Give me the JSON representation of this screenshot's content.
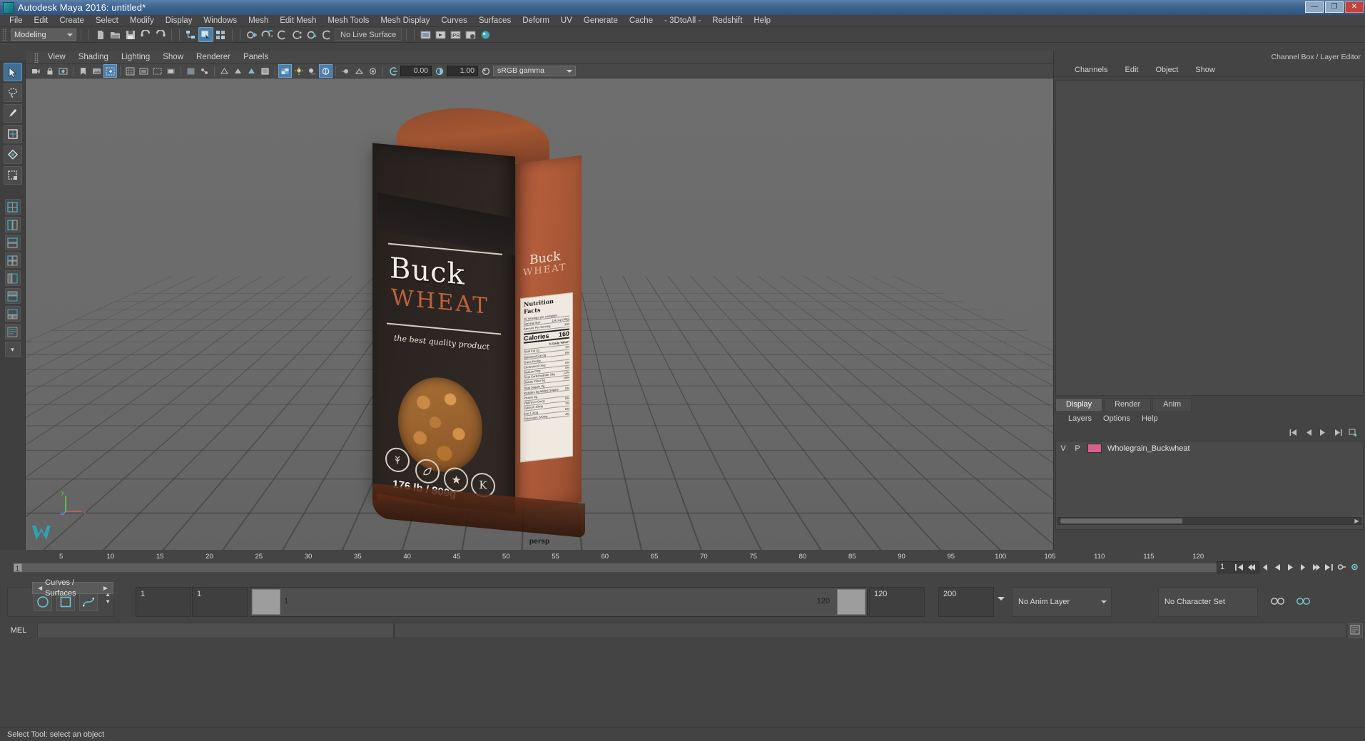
{
  "window": {
    "title": "Autodesk Maya 2016: untitled*",
    "minimize_label": "—",
    "maximize_label": "❐",
    "close_label": "✕"
  },
  "menubar": {
    "items": [
      "File",
      "Edit",
      "Create",
      "Select",
      "Modify",
      "Display",
      "Windows",
      "Mesh",
      "Edit Mesh",
      "Mesh Tools",
      "Mesh Display",
      "Curves",
      "Surfaces",
      "Deform",
      "UV",
      "Generate",
      "Cache",
      "- 3DtoAll -",
      "Redshift",
      "Help"
    ]
  },
  "toolbar": {
    "mode": "Modeling",
    "live_surface": "No Live Surface",
    "icons": [
      "new-scene-icon",
      "open-scene-icon",
      "save-scene-icon",
      "undo-icon",
      "redo-icon",
      "select-by-hierarchy-icon",
      "select-by-object-icon",
      "select-by-component-icon",
      "snap-to-grid-icon",
      "snap-to-curve-icon",
      "snap-to-point-icon",
      "snap-to-projected-center-icon",
      "snap-to-view-plane-icon",
      "make-live-icon",
      "render-view-icon",
      "render-current-frame-icon",
      "ipr-render-icon",
      "render-settings-icon",
      "hypershade-icon"
    ]
  },
  "toolbox": {
    "tools": [
      {
        "name": "select-tool",
        "icon": "arrow-cursor-icon",
        "selected": true
      },
      {
        "name": "lasso-select-tool",
        "icon": "lasso-icon",
        "selected": false
      },
      {
        "name": "paint-select-tool",
        "icon": "paint-brush-icon",
        "selected": false
      },
      {
        "name": "move-tool",
        "icon": "move-arrows-icon",
        "selected": false
      },
      {
        "name": "rotate-tool",
        "icon": "rotate-ring-icon",
        "selected": false
      },
      {
        "name": "scale-tool",
        "icon": "scale-box-icon",
        "selected": false
      },
      {
        "name": "last-tool",
        "icon": "last-tool-icon",
        "selected": false
      }
    ],
    "layout_presets": [
      "single-perspective-layout",
      "two-pane-side-layout",
      "two-pane-stacked-layout",
      "four-pane-layout",
      "persp-outliner-layout",
      "hypershade-layout",
      "persp-graph-layout",
      "outliner-layout"
    ],
    "more_label": "▾"
  },
  "viewport": {
    "menus": [
      "View",
      "Shading",
      "Lighting",
      "Show",
      "Renderer",
      "Panels"
    ],
    "camera_label": "persp",
    "exposure_value": "0.00",
    "gamma_value": "1.00",
    "color_space": "sRGB gamma",
    "toolbar_icons": [
      "select-camera-icon",
      "lock-camera-icon",
      "camera-attributes-icon",
      "bookmark-icon",
      "image-plane-icon",
      "two-d-pan-zoom-icon",
      "grid-toggle-icon",
      "film-gate-icon",
      "resolution-gate-icon",
      "gate-mask-icon",
      "xray-toggle-icon",
      "xray-joints-icon",
      "wireframe-icon",
      "smooth-shade-all-icon",
      "smooth-shade-selected-icon",
      "wireframe-on-shaded-icon",
      "texture-toggle-icon",
      "lights-toggle-icon",
      "shadows-toggle-icon",
      "screen-space-ao-icon",
      "motion-blur-icon",
      "multisample-icon",
      "depth-of-field-icon",
      "exposure-icon",
      "gamma-icon",
      "color-management-icon"
    ]
  },
  "model": {
    "brand_line1": "Buck",
    "brand_line2": "WHEAT",
    "tagline": "the best quality product",
    "weight": "176 lb / 800g",
    "side_brand_line1": "Buck",
    "side_brand_line2": "WHEAT",
    "seals": [
      "wheat-sheaf-seal",
      "leaf-seal",
      "star-seal",
      "kosher-k-seal"
    ],
    "nutrition": {
      "title": "Nutrition Facts",
      "servings": "10 servings per container",
      "serving_size_label": "Serving Size",
      "serving_size_value": "1/4 cup (40g)",
      "amount_label": "Amount Per Serving",
      "amount_value": "160",
      "calories_label": "Calories",
      "calories_value": "160",
      "dv_header": "% Daily Value*",
      "rows": [
        {
          "label": "Total Fat 1g",
          "value": "1%"
        },
        {
          "label": "Saturated Fat 0g",
          "value": "0%"
        },
        {
          "label": "Trans Fat 0g",
          "value": ""
        },
        {
          "label": "Cholesterol 0mg",
          "value": "0%"
        },
        {
          "label": "Sodium 0mg",
          "value": "0%"
        },
        {
          "label": "Total Carbohydrate 33g",
          "value": "12%"
        },
        {
          "label": "Dietary Fiber 5g",
          "value": "18%"
        },
        {
          "label": "Total Sugars 0g",
          "value": ""
        },
        {
          "label": "Includes 0g Added Sugars",
          "value": "0%"
        },
        {
          "label": "Protein 6g",
          "value": ""
        },
        {
          "label": "Vitamin D 0mcg",
          "value": "0%"
        },
        {
          "label": "Calcium 10mg",
          "value": "1%"
        },
        {
          "label": "Iron 1.3mg",
          "value": "8%"
        },
        {
          "label": "Potassium 220mg",
          "value": "4%"
        }
      ]
    }
  },
  "channelbox": {
    "header": "Channel Box / Layer Editor",
    "tabs": [
      "Channels",
      "Edit",
      "Object",
      "Show"
    ],
    "side_icons": [
      "channel-box-toggle-icon",
      "attribute-editor-toggle-icon",
      "tool-settings-icon"
    ]
  },
  "layereditor": {
    "tabs": [
      {
        "label": "Display",
        "active": true
      },
      {
        "label": "Render",
        "active": false
      },
      {
        "label": "Anim",
        "active": false
      }
    ],
    "menus": [
      "Layers",
      "Options",
      "Help"
    ],
    "icon_row": [
      "layer-first-icon",
      "layer-prev-icon",
      "layer-next-icon",
      "layer-last-icon",
      "new-layer-icon"
    ],
    "columns": [
      "V",
      "P"
    ],
    "layers": [
      {
        "visible": "V",
        "playback": "P",
        "color": "#d95f8c",
        "name": "Wholegrain_Buckwheat"
      }
    ],
    "scroll_left": "◀",
    "scroll_right": "▶"
  },
  "timeslider": {
    "ticks": [
      "5",
      "10",
      "15",
      "20",
      "25",
      "30",
      "35",
      "40",
      "45",
      "50",
      "55",
      "60",
      "65",
      "70",
      "75",
      "80",
      "85",
      "90",
      "95",
      "100",
      "105",
      "110",
      "115",
      "120"
    ],
    "current_frame_marker": "1",
    "current_frame_field": "1",
    "playback_icons": [
      "go-to-start-icon",
      "step-back-frame-icon",
      "step-back-key-icon",
      "play-backwards-icon",
      "play-forwards-icon",
      "step-forward-key-icon",
      "step-forward-frame-icon",
      "go-to-end-icon",
      "auto-key-icon",
      "anim-prefs-icon"
    ]
  },
  "rangebar": {
    "shelf_tab": "Curves / Surfaces",
    "shelf_buttons": [
      "nurbs-circle-icon",
      "nurbs-square-icon",
      "curve-tool-icon"
    ],
    "shelf_arrows": {
      "left": "◀",
      "right": "▶",
      "up": "▲",
      "down": "▼"
    },
    "anim_start": "1",
    "playback_start": "1",
    "range_start_label": "1",
    "range_end_label": "120",
    "playback_end": "120",
    "anim_end": "200",
    "anim_layer": "No Anim Layer",
    "character_set": "No Character Set",
    "settings_icon": "anim-layer-settings-icon",
    "char-set-icon": "character-set-icon"
  },
  "command": {
    "mel_label": "MEL",
    "input_value": "",
    "output_value": "",
    "script_editor_icon": "script-editor-icon"
  },
  "statusline": {
    "message": "Select Tool: select an object"
  },
  "colors": {
    "title_bar": "#2f5480",
    "accent_blue": "#4e7fa8",
    "panel_bg": "#444444",
    "viewport_bg": "#6e6e6e",
    "layer_swatch": "#d95f8c"
  }
}
